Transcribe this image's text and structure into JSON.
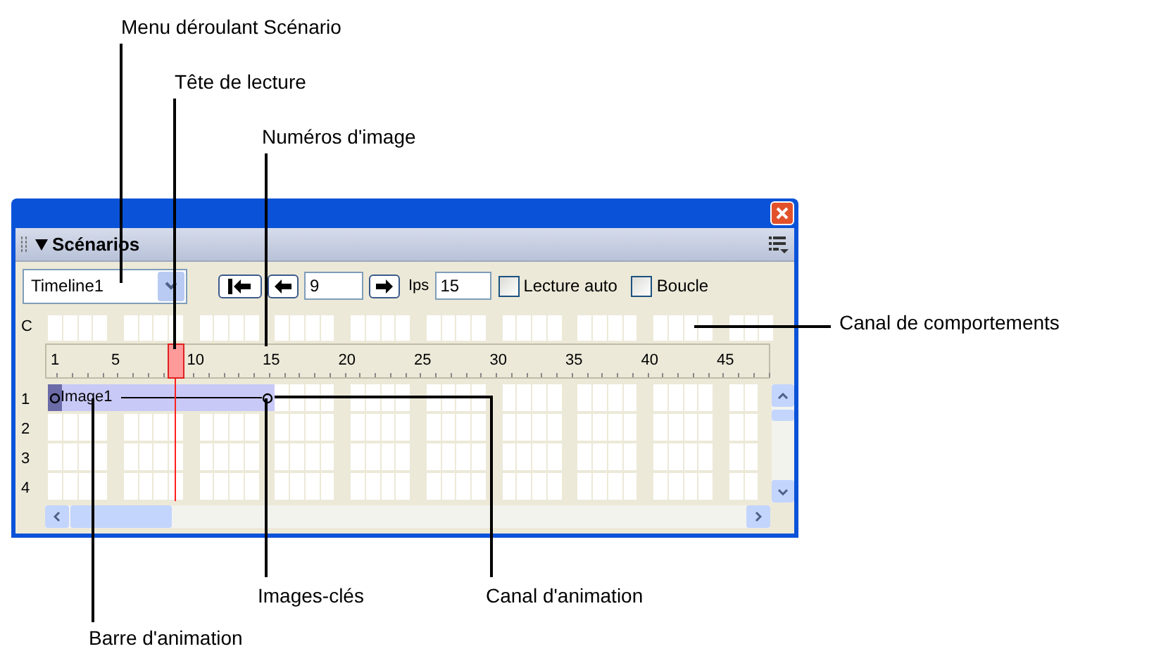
{
  "callouts": [
    {
      "text": "Menu déroulant Scénario"
    },
    {
      "text": "Tête de lecture"
    },
    {
      "text": "Numéros d'image"
    },
    {
      "text": "Canal de comportements"
    },
    {
      "text": "Images-clés"
    },
    {
      "text": "Canal d'animation"
    },
    {
      "text": "Barre d'animation"
    }
  ],
  "panel": {
    "title": "Scénarios",
    "expanded": true,
    "toolbar": {
      "timeline_menu": "Timeline1",
      "frame": "9",
      "fps_label": "Ips",
      "fps": "15",
      "checkboxes": [
        {
          "label": "Lecture auto",
          "checked": false
        },
        {
          "label": "Boucle",
          "checked": false
        }
      ]
    },
    "behaviors_channel_label": "C",
    "frame_numbers": [
      "1",
      "5",
      "10",
      "15",
      "20",
      "25",
      "30",
      "35",
      "40",
      "45"
    ],
    "rows": [
      "1",
      "2",
      "3",
      "4"
    ],
    "sprite": {
      "name": "Image1"
    }
  }
}
